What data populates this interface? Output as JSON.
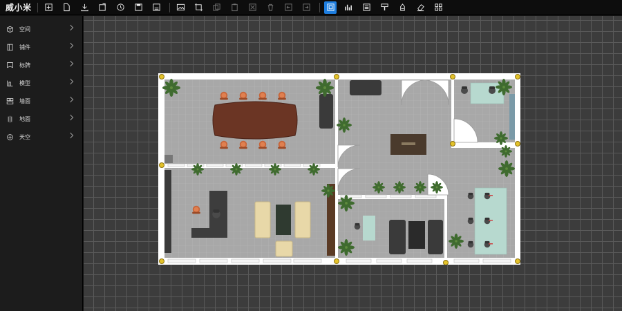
{
  "app": {
    "name": "威小米"
  },
  "toolbar": {
    "buttons": [
      {
        "icon": "new-file-icon",
        "state": "normal"
      },
      {
        "icon": "open-file-icon",
        "state": "normal"
      },
      {
        "icon": "download-icon",
        "state": "normal"
      },
      {
        "icon": "import-icon",
        "state": "normal"
      },
      {
        "icon": "history-icon",
        "state": "normal"
      },
      {
        "icon": "save-icon",
        "state": "normal"
      },
      {
        "icon": "save-as-icon",
        "state": "normal"
      },
      {
        "icon": "image-icon",
        "state": "normal"
      },
      {
        "icon": "crop-icon",
        "state": "normal"
      },
      {
        "icon": "copy-icon",
        "state": "disabled"
      },
      {
        "icon": "paste-icon",
        "state": "disabled"
      },
      {
        "icon": "cut-icon",
        "state": "disabled"
      },
      {
        "icon": "delete-icon",
        "state": "disabled"
      },
      {
        "icon": "undo-icon",
        "state": "disabled"
      },
      {
        "icon": "redo-icon",
        "state": "disabled"
      },
      {
        "icon": "plan-view-icon",
        "state": "active"
      },
      {
        "icon": "3d-view-icon",
        "state": "normal"
      },
      {
        "icon": "layers-icon",
        "state": "normal"
      },
      {
        "icon": "paint-icon",
        "state": "normal"
      },
      {
        "icon": "lock-icon",
        "state": "normal"
      },
      {
        "icon": "eraser-icon",
        "state": "normal"
      },
      {
        "icon": "grid-icon",
        "state": "normal"
      }
    ]
  },
  "sidebar": {
    "items": [
      {
        "label": "空间",
        "icon": "cube-icon"
      },
      {
        "label": "铺件",
        "icon": "door-icon"
      },
      {
        "label": "标牌",
        "icon": "signboard-icon"
      },
      {
        "label": "模型",
        "icon": "model-icon"
      },
      {
        "label": "墙面",
        "icon": "wall-icon"
      },
      {
        "label": "地面",
        "icon": "floor-icon"
      },
      {
        "label": "天空",
        "icon": "sky-icon"
      }
    ]
  },
  "colors": {
    "accent": "#1e7ee0",
    "canvas_bg": "#3c3c3c",
    "grid_line": "#5a5a5a",
    "floor": "#a9a9a9",
    "wall": "#ffffff",
    "anchor": "#e3c22a",
    "conference_table": "#6b3524",
    "chair": "#c7653a",
    "sofa": "#3a3a3a",
    "plant": "#3f6b2f",
    "desk_glass": "#b7d9cf"
  }
}
